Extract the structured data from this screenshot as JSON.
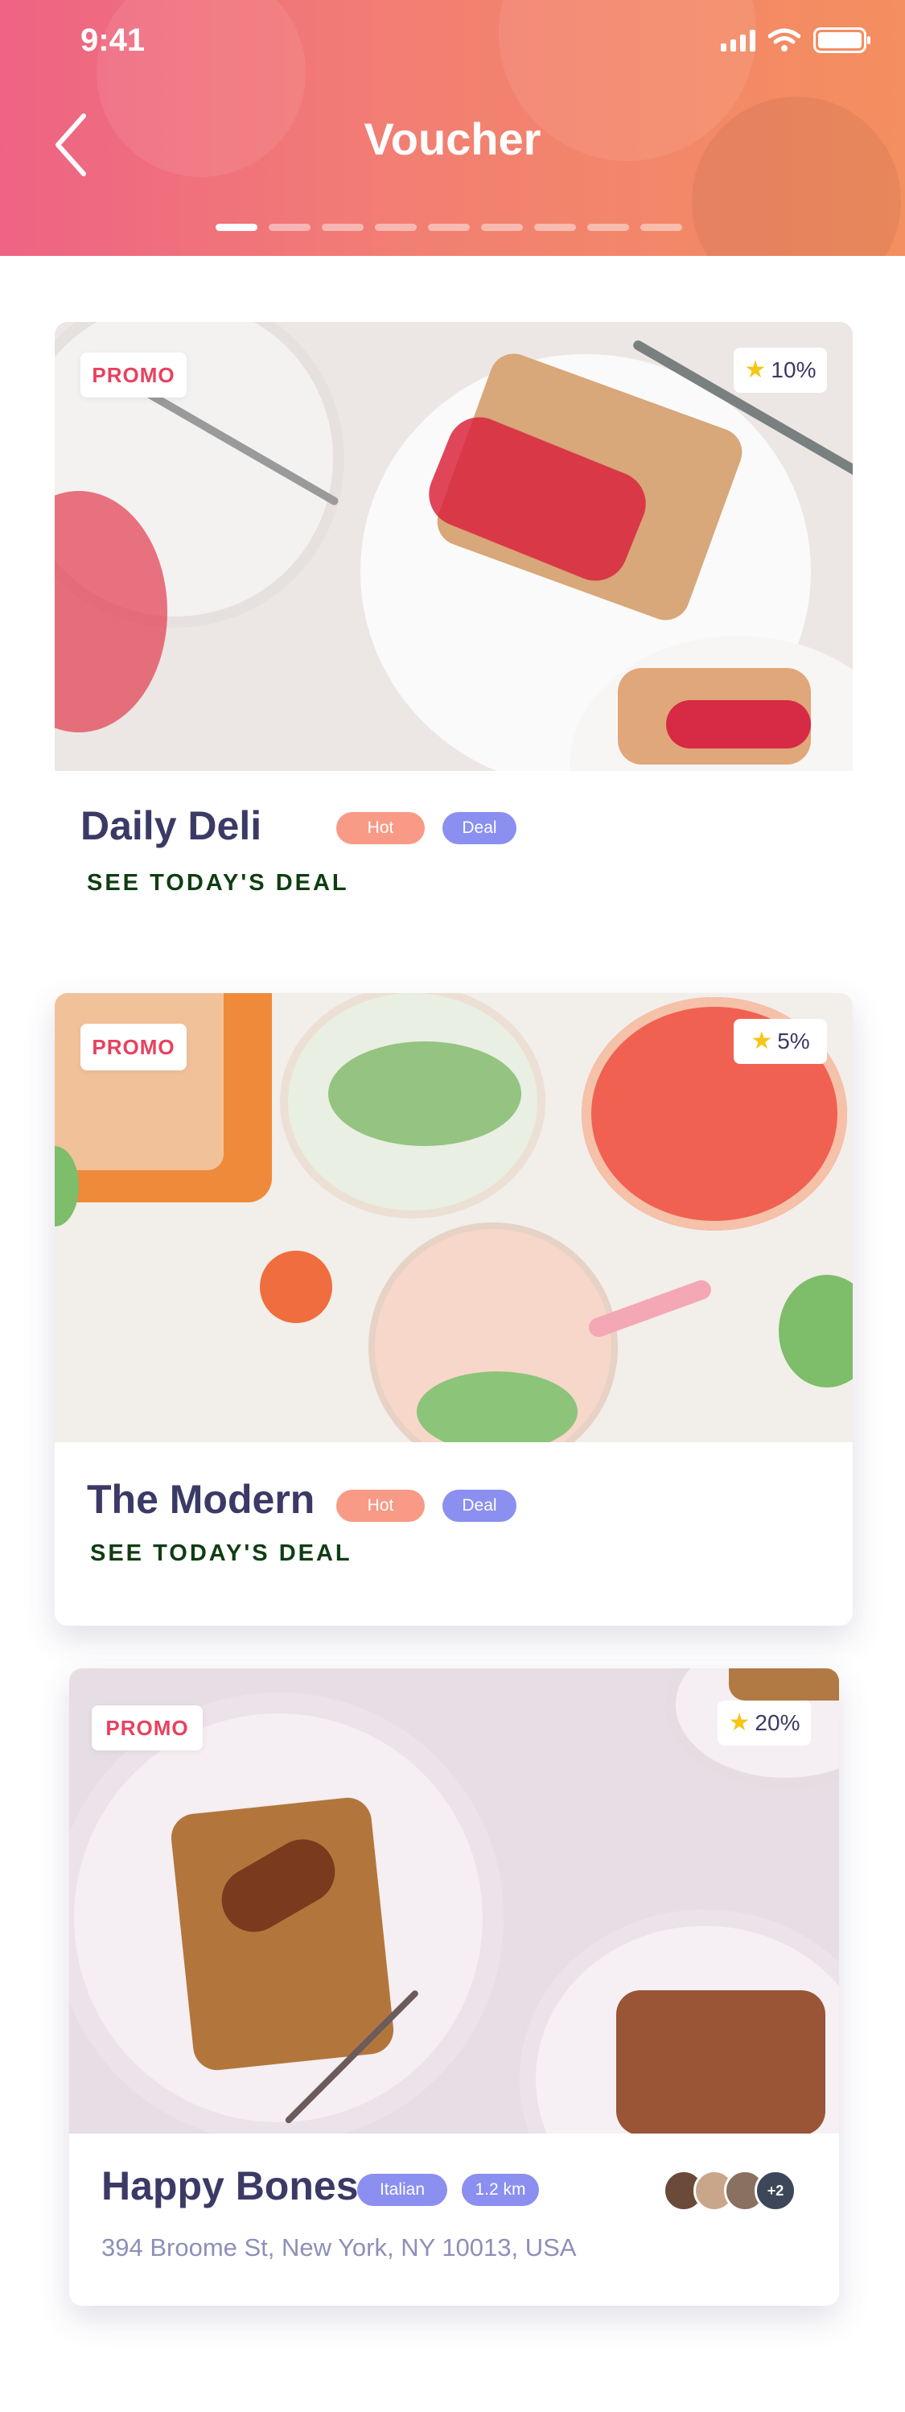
{
  "status_bar": {
    "time": "9:41"
  },
  "header": {
    "title": "Voucher",
    "pager": {
      "count": 9,
      "active": 0
    }
  },
  "vouchers": [
    {
      "promo": "PROMO",
      "rating": "10%",
      "name": "Daily Deli",
      "tags": [
        "Hot",
        "Deal"
      ],
      "cta": "SEE TODAY'S DEAL"
    },
    {
      "promo": "PROMO",
      "rating": "5%",
      "name": "The Modern",
      "tags": [
        "Hot",
        "Deal"
      ],
      "cta": "SEE TODAY'S DEAL"
    },
    {
      "promo": "PROMO",
      "rating": "20%",
      "name": "Happy Bones",
      "tags": [
        "Italian",
        "1.2 km"
      ],
      "address": "394 Broome St, New York, NY 10013, USA",
      "avatars_more": "+2"
    }
  ],
  "colors": {
    "header_gradient_start": "#ee6384",
    "header_gradient_end": "#f48f5f",
    "promo_text": "#e8415e",
    "hot_tag": "#f89a86",
    "deal_tag": "#8a8ff0",
    "cta_text": "#0f3d12",
    "title_text": "#3b3a66",
    "star": "#f5c518"
  }
}
